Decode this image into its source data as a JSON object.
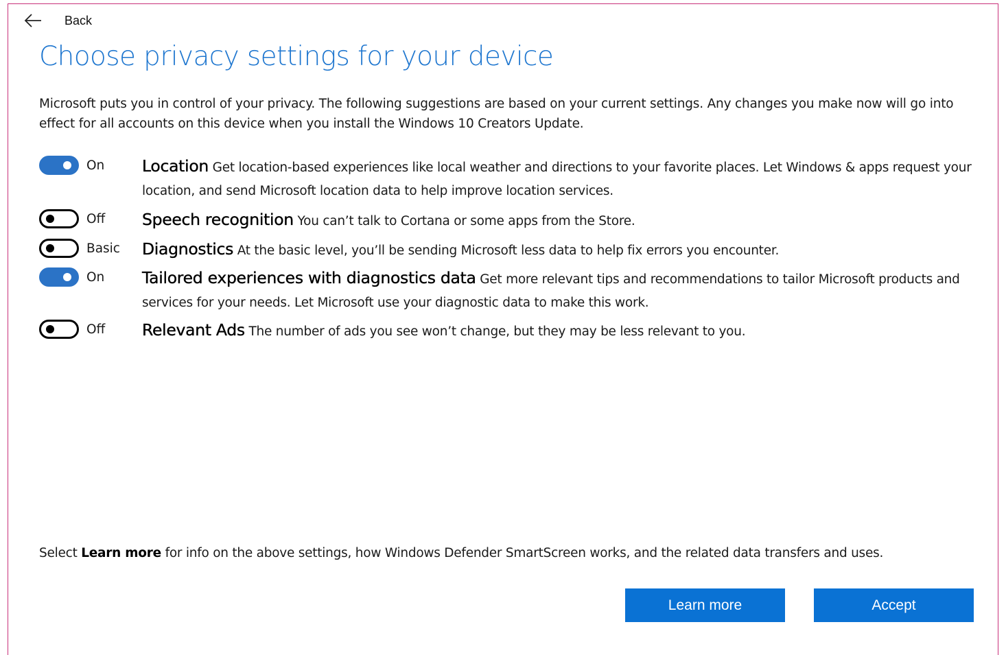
{
  "header": {
    "back_label": "Back",
    "title": "Choose privacy settings for your device"
  },
  "intro": "Microsoft puts you in control of your privacy. The following suggestions are based on your current settings. Any changes you make now will go into effect for all accounts on this device when you install the Windows 10 Creators Update.",
  "settings": [
    {
      "state": "On",
      "toggle": "on",
      "name": "Location",
      "description": "Get location-based experiences like local weather and directions to your favorite places. Let Windows & apps request your location, and send Microsoft location data to help improve location services."
    },
    {
      "state": "Off",
      "toggle": "off",
      "name": "Speech recognition",
      "description": "You can’t talk to Cortana or some apps from the Store."
    },
    {
      "state": "Basic",
      "toggle": "off",
      "name": "Diagnostics",
      "description": "At the basic level, you’ll be sending Microsoft less data to help fix errors you encounter."
    },
    {
      "state": "On",
      "toggle": "on",
      "name": "Tailored experiences with diagnostics data",
      "description": "Get more relevant tips and recommendations to tailor Microsoft products and services for your needs. Let Microsoft use your diagnostic data to make this work."
    },
    {
      "state": "Off",
      "toggle": "off",
      "name": "Relevant Ads",
      "description": "The number of ads you see won’t change, but they may be less relevant to you."
    }
  ],
  "footer": {
    "note_prefix": "Select",
    "note_bold": "Learn more",
    "note_suffix": "for info on the above settings, how Windows Defender SmartScreen works, and the related data transfers and uses."
  },
  "buttons": {
    "learn_more": "Learn more",
    "accept": "Accept"
  },
  "colors": {
    "accent": "#1e76cf",
    "toggle_on": "#2b73c6",
    "button": "#0a72d4",
    "frame_border": "#c8307a"
  },
  "icons": {
    "back": "arrow-left-icon"
  }
}
